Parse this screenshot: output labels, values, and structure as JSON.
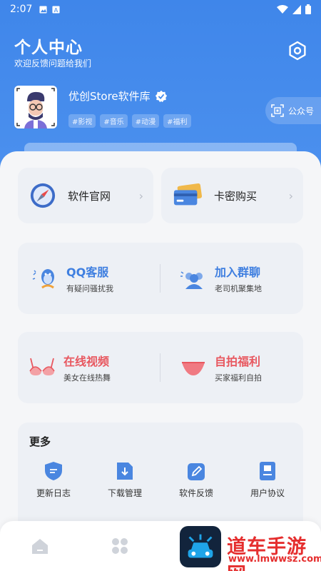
{
  "status_bar": {
    "time": "2:07"
  },
  "header": {
    "title": "个人中心",
    "subtitle": "欢迎反馈问题给我们",
    "app_name": "优创Store软件库",
    "tags": [
      "#影视",
      "#音乐",
      "#动漫",
      "#福利"
    ],
    "gzh_label": "公众号"
  },
  "links": [
    {
      "label": "软件官网",
      "icon": "compass-icon"
    },
    {
      "label": "卡密购买",
      "icon": "card-icon"
    }
  ],
  "contact_card": {
    "left": {
      "title": "QQ客服",
      "sub": "有疑问骚扰我",
      "icon": "qq-penguin-icon"
    },
    "right": {
      "title": "加入群聊",
      "sub": "老司机聚集地",
      "icon": "group-icon"
    }
  },
  "media_card": {
    "left": {
      "title": "在线视频",
      "sub": "美女在线热舞",
      "icon": "bra-icon"
    },
    "right": {
      "title": "自拍福利",
      "sub": "买家福利自拍",
      "icon": "panties-icon"
    }
  },
  "more": {
    "title": "更多",
    "items": [
      {
        "label": "更新日志",
        "icon": "shield-icon"
      },
      {
        "label": "下载管理",
        "icon": "download-icon"
      },
      {
        "label": "软件反馈",
        "icon": "edit-icon"
      },
      {
        "label": "用户协议",
        "icon": "document-icon"
      }
    ]
  },
  "bottom_nav": [
    {
      "icon": "home-icon"
    },
    {
      "icon": "apps-grid-icon"
    }
  ],
  "watermark": {
    "text": "道车手游网",
    "url": "www.lmwwsz.com"
  },
  "colors": {
    "primary": "#4289ec",
    "accent_blue": "#3f7fe0",
    "accent_red": "#e8575f",
    "card_bg": "#edf0f5"
  }
}
